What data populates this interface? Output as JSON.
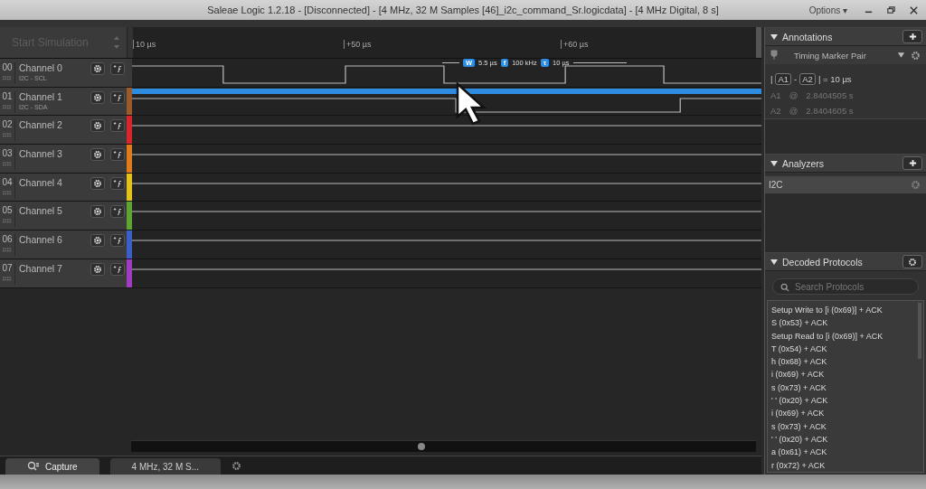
{
  "window": {
    "title": "Saleae Logic 1.2.18 - [Disconnected] - [4 MHz, 32 M Samples [46]_i2c_command_Sr.logicdata] - [4 MHz Digital, 8 s]",
    "options": "Options ▾"
  },
  "simulation": {
    "label": "Start Simulation",
    "disabled": true
  },
  "ruler": {
    "ticks": [
      "10 µs",
      "+50 µs",
      "+60 µs"
    ]
  },
  "measurements": [
    {
      "symbol": "W",
      "value": "5.5 µs"
    },
    {
      "symbol": "f",
      "value": "100 kHz"
    },
    {
      "symbol": "τ",
      "value": "10 µs"
    }
  ],
  "channels": [
    {
      "number": "00",
      "name": "Channel 0",
      "analyzer": "I2C - SCL",
      "color": "#3a3a3a",
      "selected": false
    },
    {
      "number": "01",
      "name": "Channel 1",
      "analyzer": "I2C - SDA",
      "color": "#9b5a2a",
      "selected": true
    },
    {
      "number": "02",
      "name": "Channel 2",
      "color": "#d8262a",
      "selected": false
    },
    {
      "number": "03",
      "name": "Channel 3",
      "color": "#e07b1c",
      "selected": false
    },
    {
      "number": "04",
      "name": "Channel 4",
      "color": "#e3c21a",
      "selected": false
    },
    {
      "number": "05",
      "name": "Channel 5",
      "color": "#5ea431",
      "selected": false
    },
    {
      "number": "06",
      "name": "Channel 6",
      "color": "#3b5fc8",
      "selected": false
    },
    {
      "number": "07",
      "name": "Channel 7",
      "color": "#a03cc0",
      "selected": false
    }
  ],
  "annotations": {
    "title": "Annotations",
    "marker": "Timing Marker Pair",
    "formula": [
      "|",
      "A1",
      "-",
      "A2",
      "| = 10 µs"
    ],
    "rows": [
      {
        "name": "A1",
        "at": "@",
        "value": "2.8404505 s"
      },
      {
        "name": "A2",
        "at": "@",
        "value": "2.8404605 s"
      }
    ]
  },
  "analyzers": {
    "title": "Analyzers",
    "items": [
      {
        "name": "I2C",
        "selected": true
      }
    ]
  },
  "decoded": {
    "title": "Decoded Protocols",
    "placeholder": "Search Protocols",
    "rows": [
      "Setup Write to [i (0x69)] + ACK",
      "S (0x53) + ACK",
      "Setup Read to [i (0x69)] + ACK",
      "T (0x54) + ACK",
      "h (0x68) + ACK",
      "i (0x69) + ACK",
      "s (0x73) + ACK",
      "' ' (0x20) + ACK",
      "i (0x69) + ACK",
      "s (0x73) + ACK",
      "' ' (0x20) + ACK",
      "a (0x61) + ACK",
      "r (0x72) + ACK"
    ]
  },
  "tabs": [
    {
      "label": "Capture",
      "selected": true
    },
    {
      "label": "4 MHz, 32 M S...",
      "selected": false
    }
  ]
}
